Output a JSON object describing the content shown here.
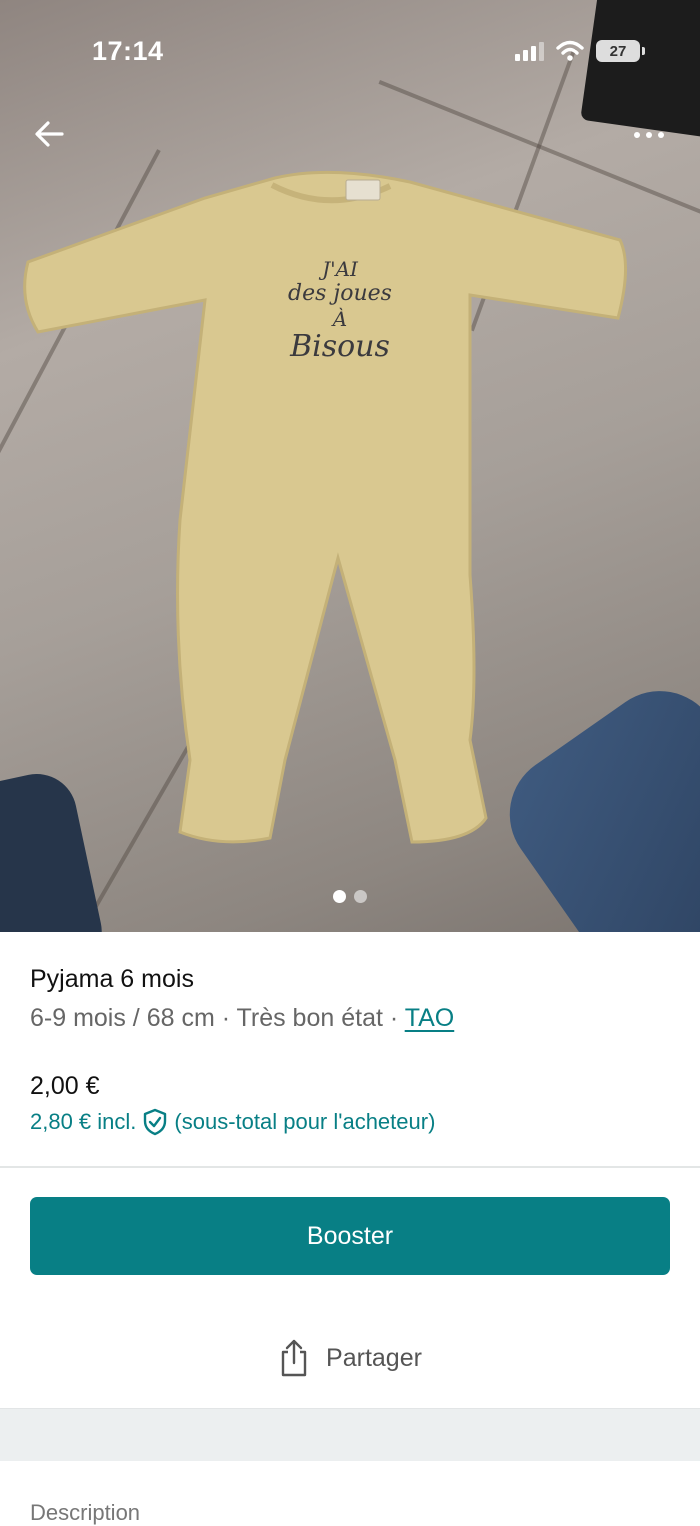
{
  "status_bar": {
    "time": "17:14",
    "battery": "27"
  },
  "photo": {
    "print_text": [
      "J'AI",
      "des joues",
      "À",
      "Bisous"
    ],
    "pager": {
      "count": 2,
      "active_index": 0
    }
  },
  "item": {
    "title": "Pyjama 6 mois",
    "meta": "6-9 mois / 68 cm · Très bon état · ",
    "brand": "TAO",
    "price": "2,00 €",
    "price_incl": "2,80 € incl.",
    "price_incl_note": "(sous-total pour l'acheteur)"
  },
  "actions": {
    "booster_label": "Booster",
    "share_label": "Partager"
  },
  "description": {
    "heading": "Description"
  },
  "colors": {
    "accent": "#087f85",
    "text": "#111111",
    "muted": "#666666",
    "band": "#eceff0"
  },
  "icons": [
    "back-arrow-icon",
    "more-icon",
    "shield-check-icon",
    "share-icon"
  ]
}
